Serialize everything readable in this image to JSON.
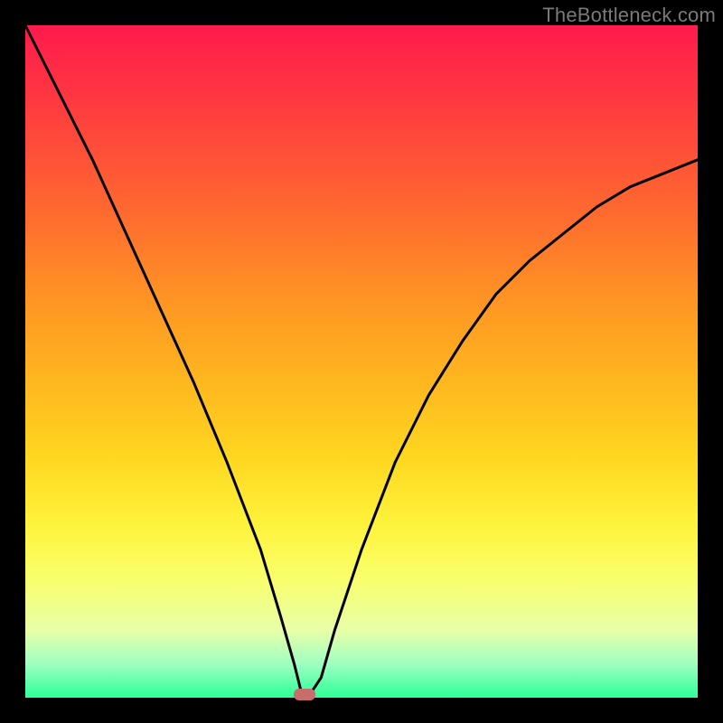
{
  "watermark": "TheBottleneck.com",
  "colors": {
    "frame": "#000000",
    "gradient_top": "#ff1a4d",
    "gradient_bottom": "#2bff98",
    "curve": "#000000",
    "marker": "#c96c6c"
  },
  "chart_data": {
    "type": "line",
    "title": "",
    "xlabel": "",
    "ylabel": "",
    "xlim": [
      0,
      100
    ],
    "ylim": [
      0,
      100
    ],
    "grid": false,
    "series": [
      {
        "name": "bottleneck-curve",
        "x": [
          0,
          5,
          10,
          15,
          20,
          25,
          30,
          35,
          38,
          40,
          41,
          42,
          44,
          46,
          50,
          55,
          60,
          65,
          70,
          75,
          80,
          85,
          90,
          95,
          100
        ],
        "values": [
          100,
          90,
          80,
          69,
          58,
          47,
          35,
          22,
          12,
          5,
          1,
          0,
          3,
          10,
          22,
          35,
          45,
          53,
          60,
          65,
          69,
          73,
          76,
          78,
          80
        ]
      }
    ],
    "annotations": [
      {
        "name": "min-marker",
        "x": 41.5,
        "y": 0
      }
    ]
  }
}
